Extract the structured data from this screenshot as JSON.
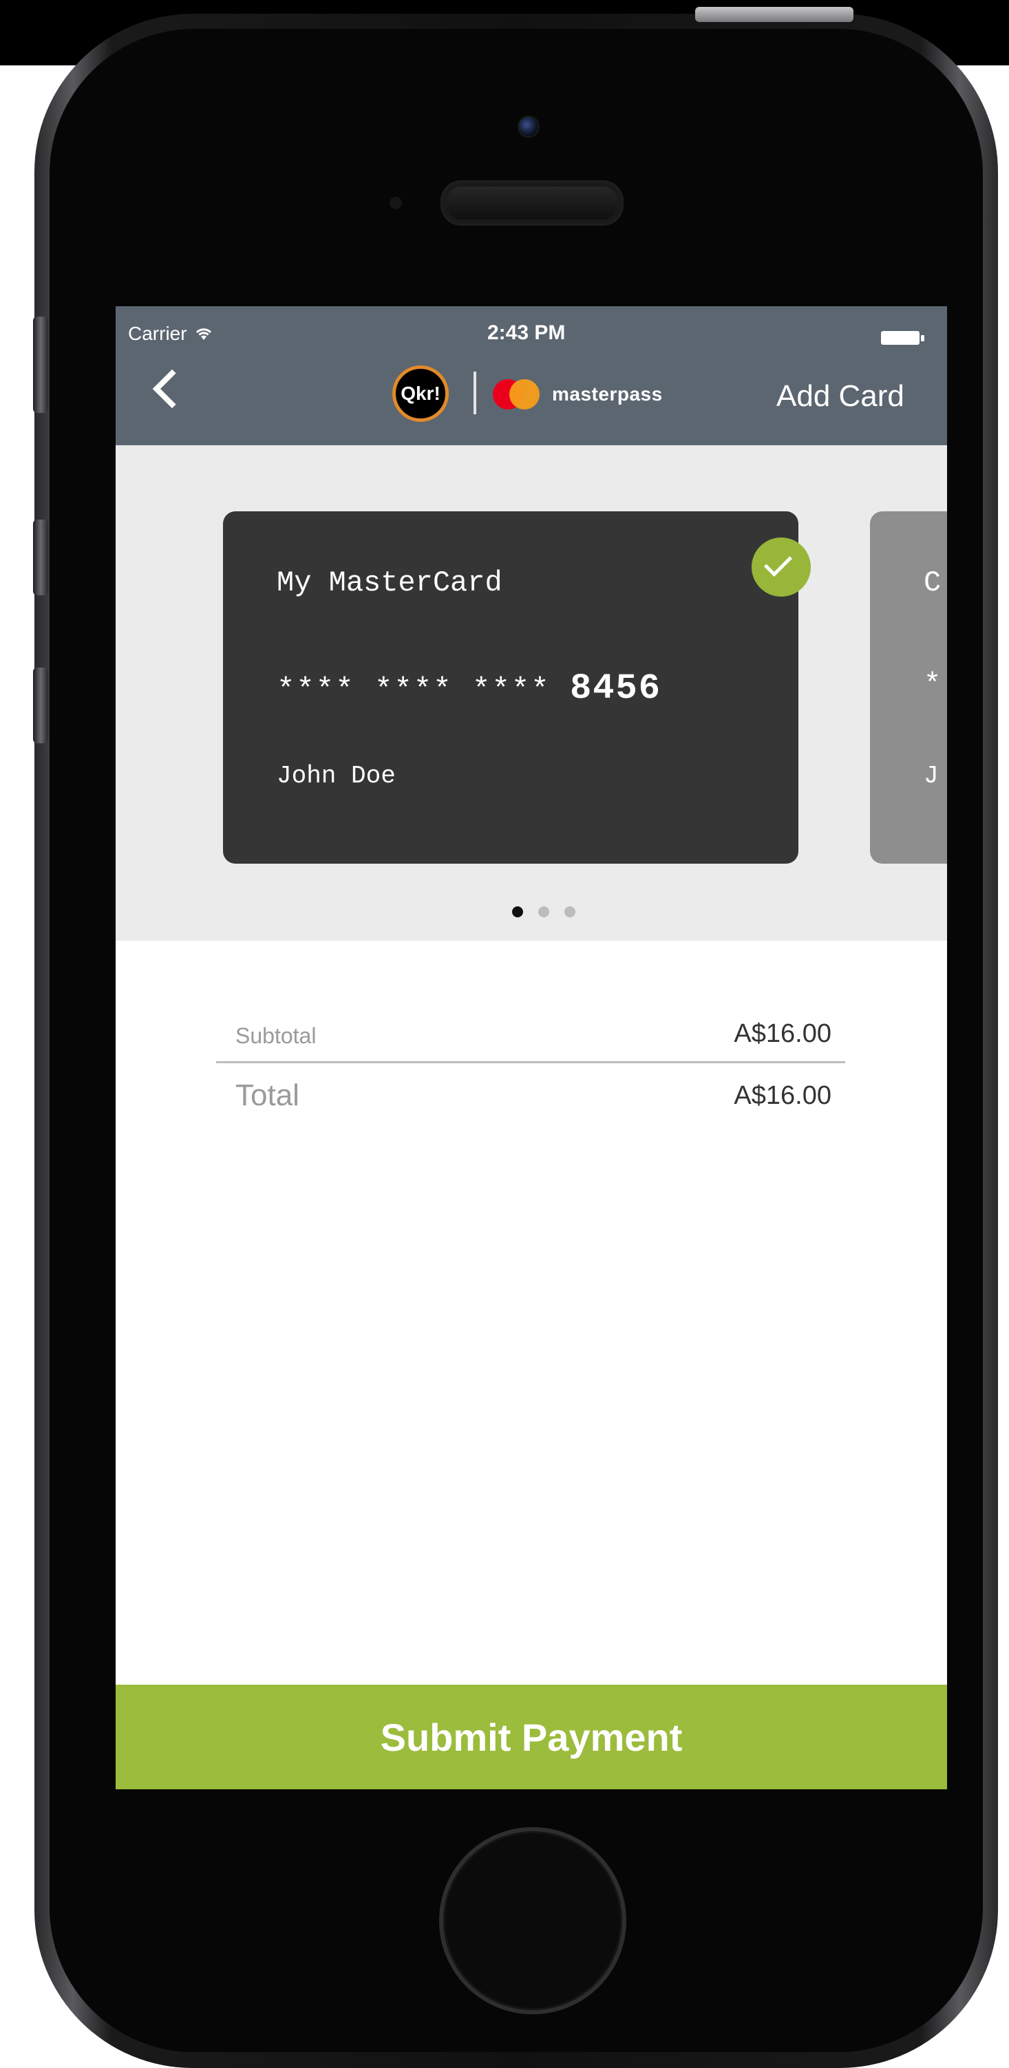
{
  "status_bar": {
    "carrier": "Carrier",
    "wifi_icon": "wifi-icon",
    "time": "2:43 PM",
    "battery_icon": "battery-icon"
  },
  "nav": {
    "back_icon": "chevron-left-icon",
    "qkr_logo_text": "Qkr!",
    "masterpass_label": "masterpass",
    "add_card_label": "Add Card"
  },
  "cards": [
    {
      "name": "My MasterCard",
      "masked": "**** **** ****",
      "last4": "8456",
      "holder": "John Doe",
      "selected": true
    },
    {
      "name_peek": "C",
      "masked_peek": "*",
      "holder_peek": "J"
    }
  ],
  "pagination": {
    "count": 3,
    "active_index": 0
  },
  "summary": {
    "subtotal_label": "Subtotal",
    "subtotal_value": "A$16.00",
    "total_label": "Total",
    "total_value": "A$16.00"
  },
  "submit_label": "Submit Payment",
  "colors": {
    "navbar": "#5c6670",
    "accent_green": "#9bbc3c",
    "card_dark": "#353535",
    "card_grey": "#8e8e8e",
    "carousel_bg": "#ebebeb"
  }
}
